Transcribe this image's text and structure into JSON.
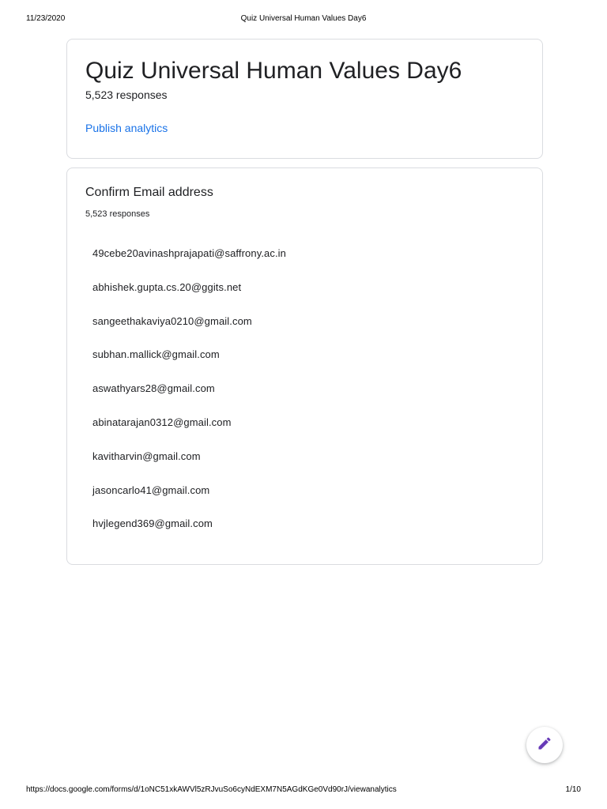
{
  "print_header": {
    "date": "11/23/2020",
    "title": "Quiz Universal Human Values Day6"
  },
  "form": {
    "title": "Quiz Universal Human Values Day6",
    "responses_count": "5,523 responses",
    "publish_link": "Publish analytics"
  },
  "question": {
    "title": "Confirm Email address",
    "responses_count": "5,523 responses",
    "responses": [
      "49cebe20avinashprajapati@saffrony.ac.in",
      "abhishek.gupta.cs.20@ggits.net",
      "sangeethakaviya0210@gmail.com",
      "subhan.mallick@gmail.com",
      "aswathyars28@gmail.com",
      "abinatarajan0312@gmail.com",
      "kavitharvin@gmail.com",
      "jasoncarlo41@gmail.com",
      "hvjlegend369@gmail.com"
    ]
  },
  "fab": {
    "icon": "pencil-icon",
    "color": "#673ab7"
  },
  "print_footer": {
    "url": "https://docs.google.com/forms/d/1oNC51xkAWVl5zRJvuSo6cyNdEXM7N5AGdKGe0Vd90rJ/viewanalytics",
    "page": "1/10"
  }
}
